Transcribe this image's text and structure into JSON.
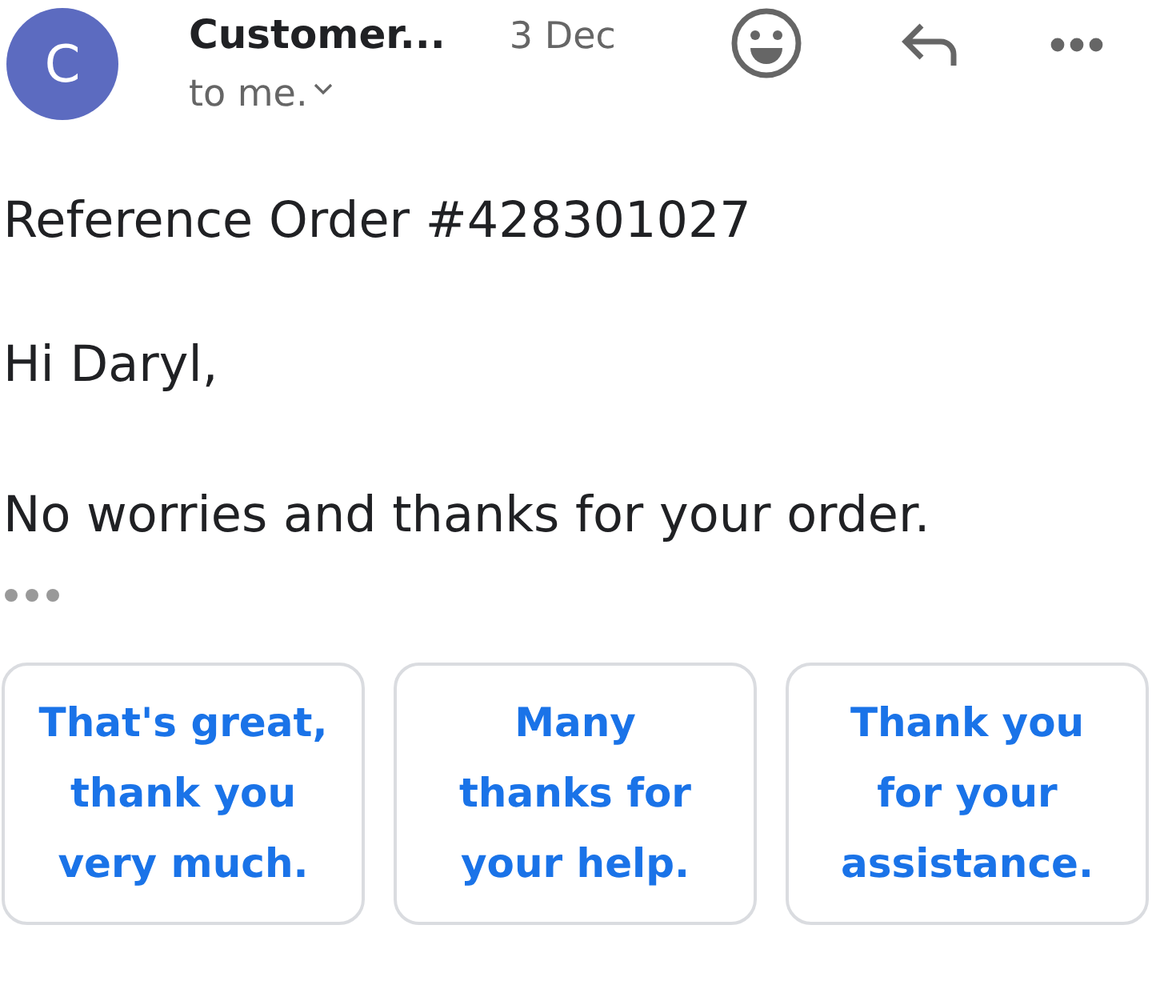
{
  "header": {
    "avatar_letter": "C",
    "sender": "Customer...",
    "date": "3 Dec",
    "recipient": "to me."
  },
  "body": {
    "subject": "Reference Order #428301027",
    "greeting": "Hi Daryl,",
    "message": "No worries and thanks for your order."
  },
  "smart_replies": [
    {
      "lines": [
        "That's great,",
        "thank you",
        "very much."
      ]
    },
    {
      "lines": [
        "Many",
        "thanks for",
        "your help."
      ]
    },
    {
      "lines": [
        "Thank you",
        "for your",
        "assistance."
      ]
    }
  ]
}
